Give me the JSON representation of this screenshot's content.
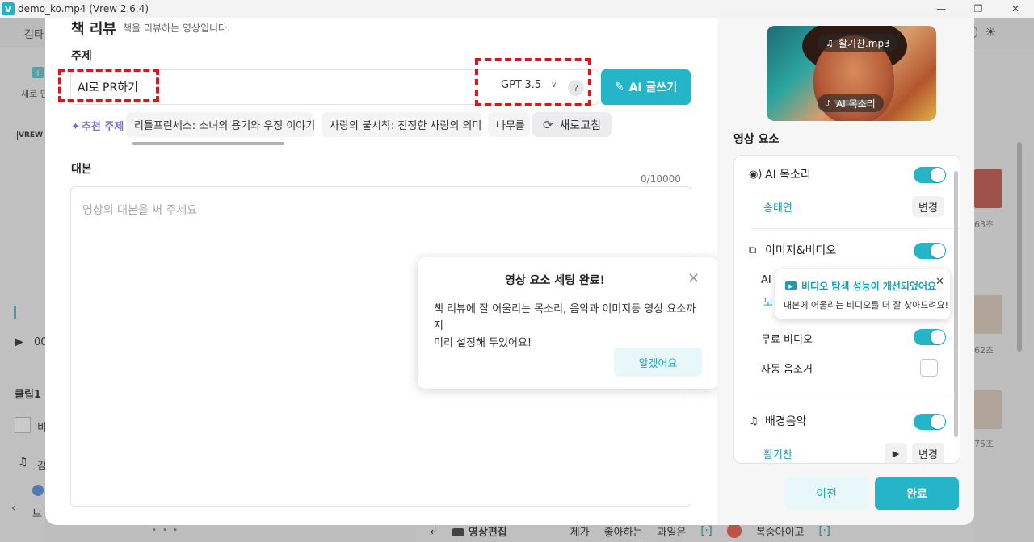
{
  "window": {
    "title": "demo_ko.mp4 (Vrew 2.6.4)",
    "logo": "V",
    "minimize": "—",
    "restore": "❐",
    "close": "✕"
  },
  "background": {
    "user_name": "김타",
    "new_label": "새로 만",
    "vrew_logo": "VREW",
    "timecode": "00",
    "clip_label": "클립1",
    "clip_text": "비",
    "music_text": "감",
    "chat_text": "브",
    "durations": [
      "63초",
      "62초",
      "75초"
    ],
    "bottom_bar": {
      "edit_label": "영상편집",
      "words": [
        "제가",
        "좋아하는",
        "과일은",
        "[·]",
        "복숭아이고",
        "[·]"
      ]
    }
  },
  "modal": {
    "title": "책 리뷰",
    "subtitle": "책을 리뷰하는 영상입니다.",
    "topic_label": "주제",
    "topic_value": "AI로 PR하기",
    "model": "GPT-3.5",
    "help": "?",
    "ai_write_label": "AI 글쓰기",
    "recommended_label": "추천 주제",
    "recommended_topics": [
      "리틀프린세스: 소녀의 용기와 우정 이야기",
      "사랑의 불시착: 진정한 사랑의 의미",
      "나무를"
    ],
    "refresh_label": "새로고침",
    "script_label": "대본",
    "char_count": "0/10000",
    "script_placeholder": "영상의 대본을 써 주세요",
    "popover": {
      "title": "영상 요소 세팅 완료!",
      "body_line1": "책 리뷰에 잘 어울리는 목소리, 음악과 이미지등 영상 요소까지",
      "body_line2": "미리 설정해 두었어요!",
      "ok_label": "알겠어요"
    },
    "preview": {
      "music_chip": "활기찬.mp3",
      "voice_chip": "AI 목소리"
    },
    "elements_label": "영상 요소",
    "elements": {
      "voice_title": "AI 목소리",
      "voice_name": "송태연",
      "change_label": "변경",
      "media_title": "이미지&비디오",
      "media_sub1": "AI 이",
      "media_sub2": "모든",
      "free_video_label": "무료 비디오",
      "auto_mute_label": "자동 음소거",
      "music_title": "배경음악",
      "music_name": "활기찬"
    },
    "tooltip": {
      "title": "비디오 탐색 성능이 개선되었어요",
      "body": "대본에 어울리는 비디오를 더 잘 찾아드려요!",
      "close": "✕"
    },
    "prev_label": "이전",
    "done_label": "완료"
  },
  "colors": {
    "accent": "#24b5c9",
    "highlight": "#e0121c",
    "recommend": "#7b6ad0"
  }
}
